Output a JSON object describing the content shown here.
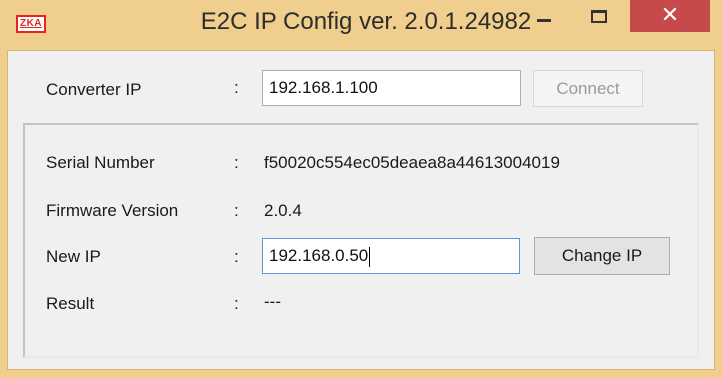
{
  "window": {
    "title": "E2C IP Config ver. 2.0.1.24982",
    "app_icon_text": "ZKA",
    "close_glyph": "✕"
  },
  "connection": {
    "label": "Converter IP",
    "colon": ":",
    "ip_value": "192.168.1.100",
    "connect_label": "Connect"
  },
  "device_info": {
    "serial_label": "Serial Number",
    "serial_value": "f50020c554ec05deaea8a44613004019",
    "firmware_label": "Firmware Version",
    "firmware_value": "2.0.4",
    "new_ip_label": "New IP",
    "new_ip_value": "192.168.0.50",
    "change_ip_label": "Change IP",
    "result_label": "Result",
    "result_value": "---",
    "colon": ":"
  },
  "colors": {
    "window_frame": "#f0ce8d",
    "close_button": "#c74a4a",
    "client_background": "#f0f0f0",
    "focused_border": "#5b9bd5"
  },
  "icons": {
    "app": "zka-logo-icon",
    "minimize": "minimize-icon",
    "maximize": "maximize-icon",
    "close": "close-icon"
  }
}
